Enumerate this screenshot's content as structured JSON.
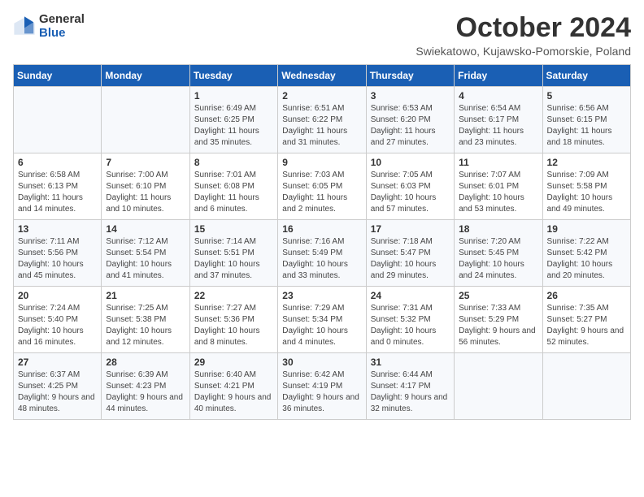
{
  "logo": {
    "general": "General",
    "blue": "Blue"
  },
  "title": "October 2024",
  "location": "Swiekatowo, Kujawsko-Pomorskie, Poland",
  "weekdays": [
    "Sunday",
    "Monday",
    "Tuesday",
    "Wednesday",
    "Thursday",
    "Friday",
    "Saturday"
  ],
  "weeks": [
    [
      {
        "day": "",
        "info": ""
      },
      {
        "day": "",
        "info": ""
      },
      {
        "day": "1",
        "info": "Sunrise: 6:49 AM\nSunset: 6:25 PM\nDaylight: 11 hours and 35 minutes."
      },
      {
        "day": "2",
        "info": "Sunrise: 6:51 AM\nSunset: 6:22 PM\nDaylight: 11 hours and 31 minutes."
      },
      {
        "day": "3",
        "info": "Sunrise: 6:53 AM\nSunset: 6:20 PM\nDaylight: 11 hours and 27 minutes."
      },
      {
        "day": "4",
        "info": "Sunrise: 6:54 AM\nSunset: 6:17 PM\nDaylight: 11 hours and 23 minutes."
      },
      {
        "day": "5",
        "info": "Sunrise: 6:56 AM\nSunset: 6:15 PM\nDaylight: 11 hours and 18 minutes."
      }
    ],
    [
      {
        "day": "6",
        "info": "Sunrise: 6:58 AM\nSunset: 6:13 PM\nDaylight: 11 hours and 14 minutes."
      },
      {
        "day": "7",
        "info": "Sunrise: 7:00 AM\nSunset: 6:10 PM\nDaylight: 11 hours and 10 minutes."
      },
      {
        "day": "8",
        "info": "Sunrise: 7:01 AM\nSunset: 6:08 PM\nDaylight: 11 hours and 6 minutes."
      },
      {
        "day": "9",
        "info": "Sunrise: 7:03 AM\nSunset: 6:05 PM\nDaylight: 11 hours and 2 minutes."
      },
      {
        "day": "10",
        "info": "Sunrise: 7:05 AM\nSunset: 6:03 PM\nDaylight: 10 hours and 57 minutes."
      },
      {
        "day": "11",
        "info": "Sunrise: 7:07 AM\nSunset: 6:01 PM\nDaylight: 10 hours and 53 minutes."
      },
      {
        "day": "12",
        "info": "Sunrise: 7:09 AM\nSunset: 5:58 PM\nDaylight: 10 hours and 49 minutes."
      }
    ],
    [
      {
        "day": "13",
        "info": "Sunrise: 7:11 AM\nSunset: 5:56 PM\nDaylight: 10 hours and 45 minutes."
      },
      {
        "day": "14",
        "info": "Sunrise: 7:12 AM\nSunset: 5:54 PM\nDaylight: 10 hours and 41 minutes."
      },
      {
        "day": "15",
        "info": "Sunrise: 7:14 AM\nSunset: 5:51 PM\nDaylight: 10 hours and 37 minutes."
      },
      {
        "day": "16",
        "info": "Sunrise: 7:16 AM\nSunset: 5:49 PM\nDaylight: 10 hours and 33 minutes."
      },
      {
        "day": "17",
        "info": "Sunrise: 7:18 AM\nSunset: 5:47 PM\nDaylight: 10 hours and 29 minutes."
      },
      {
        "day": "18",
        "info": "Sunrise: 7:20 AM\nSunset: 5:45 PM\nDaylight: 10 hours and 24 minutes."
      },
      {
        "day": "19",
        "info": "Sunrise: 7:22 AM\nSunset: 5:42 PM\nDaylight: 10 hours and 20 minutes."
      }
    ],
    [
      {
        "day": "20",
        "info": "Sunrise: 7:24 AM\nSunset: 5:40 PM\nDaylight: 10 hours and 16 minutes."
      },
      {
        "day": "21",
        "info": "Sunrise: 7:25 AM\nSunset: 5:38 PM\nDaylight: 10 hours and 12 minutes."
      },
      {
        "day": "22",
        "info": "Sunrise: 7:27 AM\nSunset: 5:36 PM\nDaylight: 10 hours and 8 minutes."
      },
      {
        "day": "23",
        "info": "Sunrise: 7:29 AM\nSunset: 5:34 PM\nDaylight: 10 hours and 4 minutes."
      },
      {
        "day": "24",
        "info": "Sunrise: 7:31 AM\nSunset: 5:32 PM\nDaylight: 10 hours and 0 minutes."
      },
      {
        "day": "25",
        "info": "Sunrise: 7:33 AM\nSunset: 5:29 PM\nDaylight: 9 hours and 56 minutes."
      },
      {
        "day": "26",
        "info": "Sunrise: 7:35 AM\nSunset: 5:27 PM\nDaylight: 9 hours and 52 minutes."
      }
    ],
    [
      {
        "day": "27",
        "info": "Sunrise: 6:37 AM\nSunset: 4:25 PM\nDaylight: 9 hours and 48 minutes."
      },
      {
        "day": "28",
        "info": "Sunrise: 6:39 AM\nSunset: 4:23 PM\nDaylight: 9 hours and 44 minutes."
      },
      {
        "day": "29",
        "info": "Sunrise: 6:40 AM\nSunset: 4:21 PM\nDaylight: 9 hours and 40 minutes."
      },
      {
        "day": "30",
        "info": "Sunrise: 6:42 AM\nSunset: 4:19 PM\nDaylight: 9 hours and 36 minutes."
      },
      {
        "day": "31",
        "info": "Sunrise: 6:44 AM\nSunset: 4:17 PM\nDaylight: 9 hours and 32 minutes."
      },
      {
        "day": "",
        "info": ""
      },
      {
        "day": "",
        "info": ""
      }
    ]
  ]
}
